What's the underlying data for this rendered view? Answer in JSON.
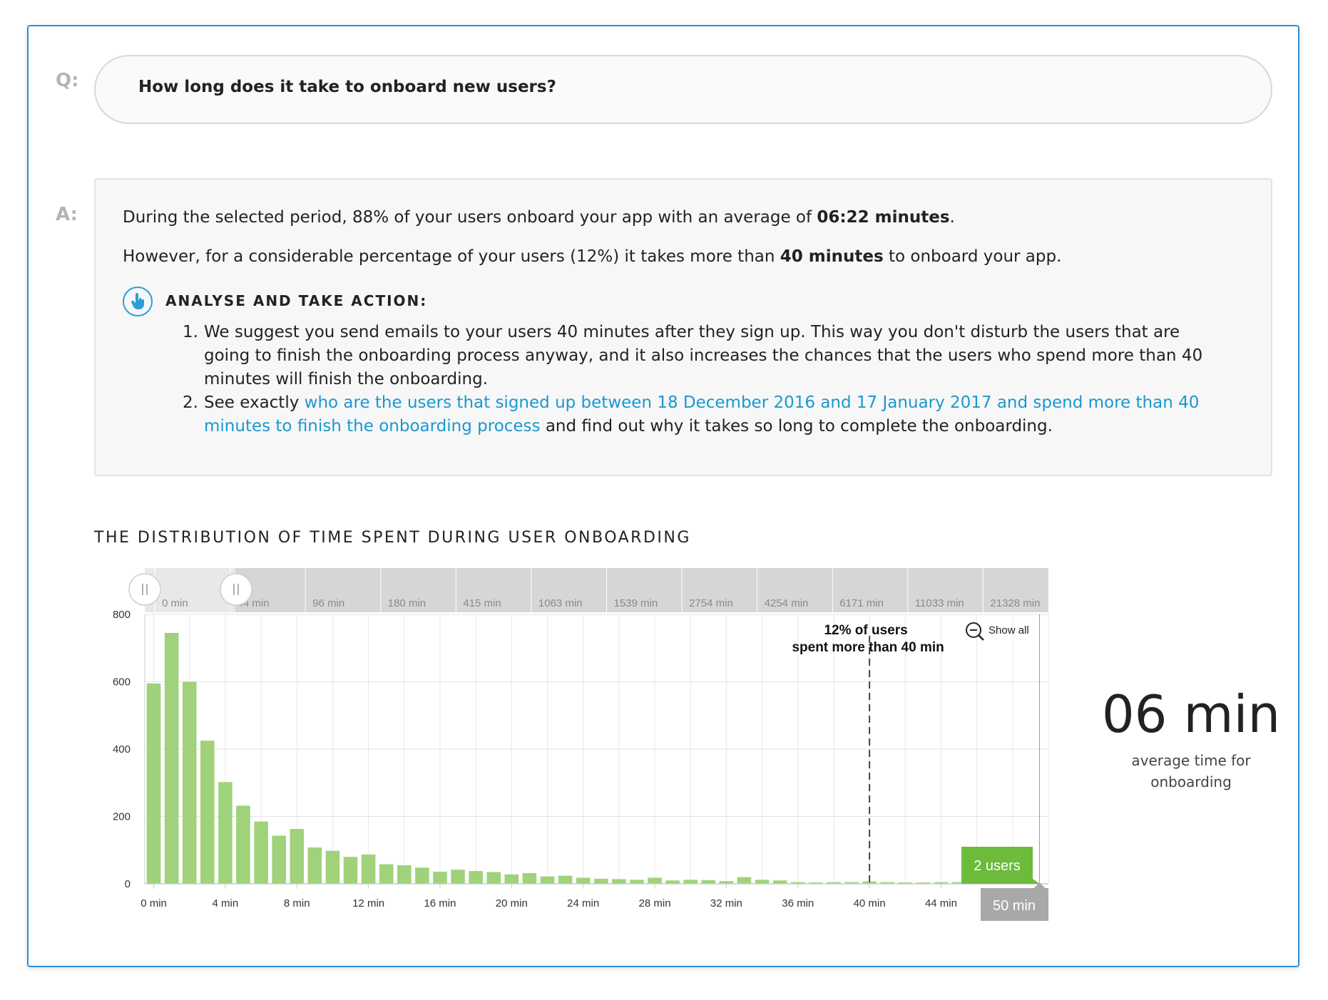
{
  "question": {
    "label": "Q:",
    "text": "How long does it take to onboard new users?"
  },
  "answer": {
    "label": "A:",
    "line1_pre": "During the selected period, 88% of your users onboard your app with an average of ",
    "line1_bold": "06:22 minutes",
    "line1_post": ".",
    "line2_pre": "However, for a considerable percentage of your users (12%) it takes more than ",
    "line2_bold": "40 minutes",
    "line2_post": " to onboard your app.",
    "action_title": "ANALYSE AND TAKE ACTION:",
    "step1_num": "1.",
    "step1_text": "We suggest you send emails to your users 40 minutes after they sign up. This way you don't disturb the users that are going to finish the onboarding process anyway, and it also increases the chances that the users who spend more than 40 minutes will finish the onboarding.",
    "step2_num": "2.",
    "step2_pre": "See exactly ",
    "step2_link": "who are the users that signed up between 18 December 2016 and 17 January 2017 and spend more than 40 minutes to finish the onboarding process",
    "step2_post": " and find out why it takes so long to complete the onboarding."
  },
  "chart_section": {
    "title": "THE DISTRIBUTION OF TIME SPENT DURING USER ONBOARDING",
    "show_all": "Show all",
    "annotation_line1": "12% of users",
    "annotation_line2": "spent more than 40 min",
    "tooltip": "2 users",
    "hover_label": "50 min",
    "colors": {
      "bar": "#9fd27a",
      "tooltip": "#6cbb3c",
      "hover_label_bg": "#a8a8a8",
      "navigator_bg": "#d6d6d6",
      "link": "#1a98d0"
    }
  },
  "chart_data": {
    "type": "bar",
    "x_unit": "min",
    "bin_width_min": 1,
    "x_start": 0,
    "values": [
      595,
      745,
      600,
      425,
      302,
      232,
      185,
      143,
      163,
      108,
      98,
      80,
      87,
      58,
      55,
      48,
      36,
      42,
      38,
      35,
      28,
      32,
      22,
      24,
      18,
      15,
      14,
      12,
      18,
      10,
      12,
      11,
      8,
      20,
      12,
      10,
      5,
      4,
      5,
      5,
      7,
      5,
      4,
      4,
      5,
      5,
      2,
      2,
      2,
      2
    ],
    "yticks": [
      0,
      200,
      400,
      600,
      800
    ],
    "ylim": [
      0,
      800
    ],
    "xticks": [
      "0 min",
      "4 min",
      "8 min",
      "12 min",
      "16 min",
      "20 min",
      "24 min",
      "28 min",
      "32 min",
      "36 min",
      "40 min",
      "44 min"
    ],
    "navigator_ticks": [
      "0 min",
      "44 min",
      "96 min",
      "180 min",
      "415 min",
      "1063 min",
      "1539 min",
      "2754 min",
      "4254 min",
      "6171 min",
      "11033 min",
      "21328 min"
    ],
    "threshold_line_min": 40,
    "grid": true,
    "legend": "none"
  },
  "average": {
    "value": "06 min",
    "label_line1": "average time for",
    "label_line2": "onboarding"
  }
}
